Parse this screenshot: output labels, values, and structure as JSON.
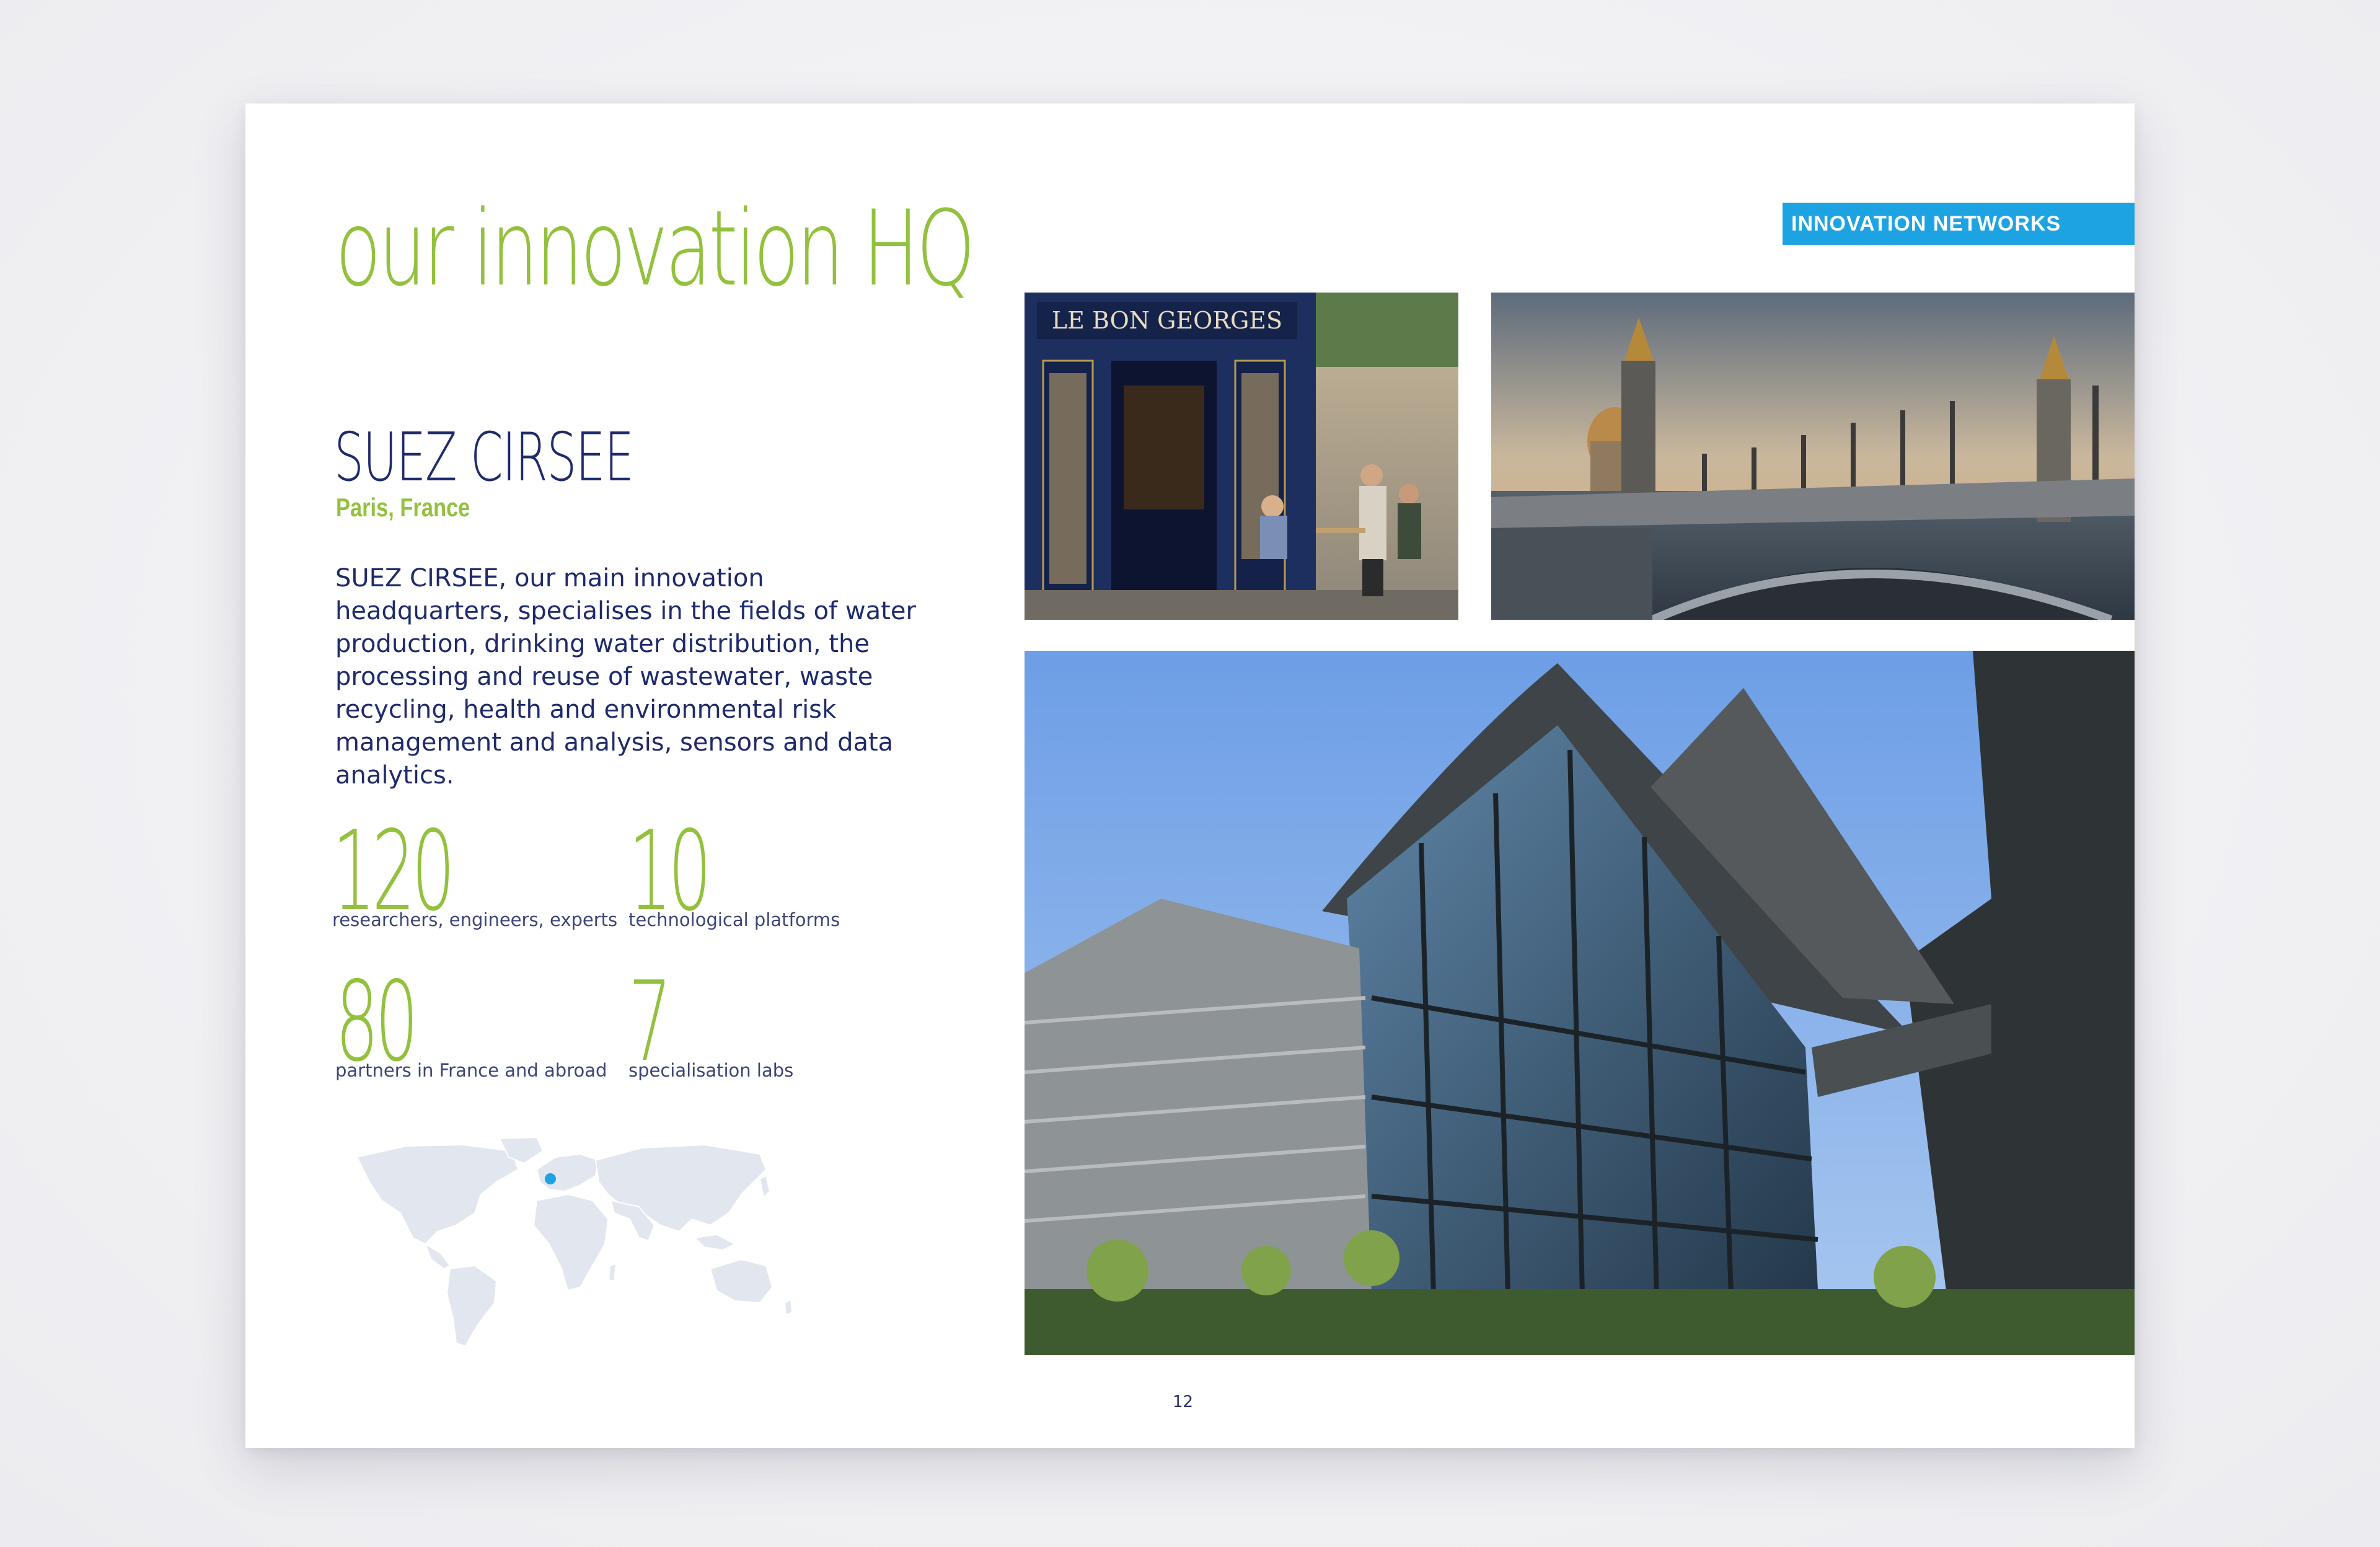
{
  "colors": {
    "green": "#93c13e",
    "navy": "#1f2a6b",
    "blue": "#1ea3e2"
  },
  "header": {
    "title": "our innovation HQ",
    "badge": "INNOVATION NETWORKS"
  },
  "org": {
    "name": "SUEZ CIRSEE",
    "location": "Paris, France",
    "description": "SUEZ CIRSEE, our main innovation headquarters, specialises in the fields of water production, drinking water distribution, the processing and reuse of wastewater, waste recycling, health and environmental risk management and analysis, sensors and data analytics."
  },
  "stats": [
    {
      "value": "120",
      "label": "researchers, engineers, experts"
    },
    {
      "value": "10",
      "label": "technological platforms"
    },
    {
      "value": "80",
      "label": "partners in France and abroad"
    },
    {
      "value": "7",
      "label": "specialisation labs"
    }
  ],
  "photos": {
    "cafe_sign": "LE BON GEORGES"
  },
  "map": {
    "marker_icon": "location-dot-icon"
  },
  "page_number": "12"
}
